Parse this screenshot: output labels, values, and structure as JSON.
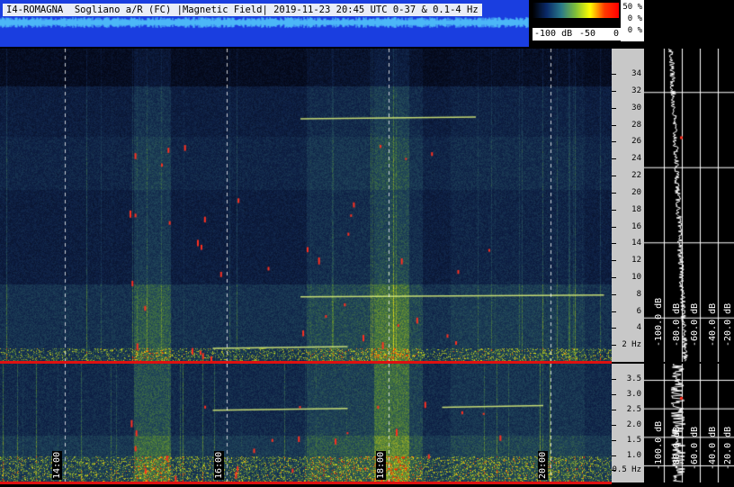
{
  "header": {
    "title": "I4-ROMAGNA  Sogliano a/R (FC) |Magnetic Field| 2019-11-23 20:45 UTC 0-37 & 0.1-4 Hz"
  },
  "colorbar": {
    "labels": [
      "-100 dB",
      "-50",
      "0"
    ],
    "colors": [
      "#000000",
      "#0a2a6a",
      "#2a7a8a",
      "#7fbf3a",
      "#ffff00",
      "#ff3a00",
      "#ff0000"
    ]
  },
  "percent_scale": {
    "labels": [
      "50 %",
      "0 %",
      "0 %"
    ]
  },
  "colors": {
    "title_bar": "#1a3ee0",
    "waveform": "#5fe0ff",
    "separator": "#dd1111",
    "axis_bg": "#c8c8c8"
  },
  "chart_data": [
    {
      "type": "heatmap",
      "name_on_chart": "",
      "x": {
        "ticks": [
          "14:00",
          "16:00",
          "18:00",
          "20:00"
        ]
      },
      "y": {
        "ticks": [
          34,
          32,
          30,
          28,
          26,
          24,
          22,
          20,
          18,
          16,
          14,
          12,
          10,
          8,
          6,
          4,
          2
        ],
        "unit_label": "Hz",
        "range": [
          0,
          37
        ]
      },
      "features": [
        {
          "time_range": [
            "15:55",
            "17:35"
          ],
          "freq_hz": 1.7
        },
        {
          "time_range": [
            "17:00",
            "20:45"
          ],
          "freq_hz": 7.8
        },
        {
          "time_range": [
            "17:00",
            "19:10"
          ],
          "freq_hz": 28.8
        }
      ]
    },
    {
      "type": "heatmap",
      "x": {
        "ticks": [
          "14:00",
          "16:00",
          "18:00",
          "20:00"
        ]
      },
      "y": {
        "ticks": [
          "3.5",
          "3.0",
          "2.5",
          "2.0",
          "1.5",
          "1.0",
          "0.5"
        ],
        "unit_label": "Hz",
        "range": [
          0.1,
          4
        ]
      },
      "features": [
        {
          "time_range": [
            "15:55",
            "17:35"
          ],
          "freq_hz": 2.5
        },
        {
          "time_range": [
            "18:45",
            "20:00"
          ],
          "freq_hz": 2.6
        }
      ]
    },
    {
      "type": "line",
      "x": {
        "ticks": [
          "-100.0 dB",
          "-80.0 dB",
          "-60.0 dB",
          "-40.0 dB",
          "-20.0 dB"
        ]
      },
      "panel": "top",
      "y_range_hz": [
        0,
        37
      ]
    },
    {
      "type": "line",
      "x": {
        "ticks": [
          "-100.0 dB",
          "-80.0 dB",
          "-60.0 dB",
          "-40.0 dB",
          "-20.0 dB"
        ]
      },
      "panel": "bottom",
      "y_range_hz": [
        0.1,
        4
      ]
    }
  ]
}
